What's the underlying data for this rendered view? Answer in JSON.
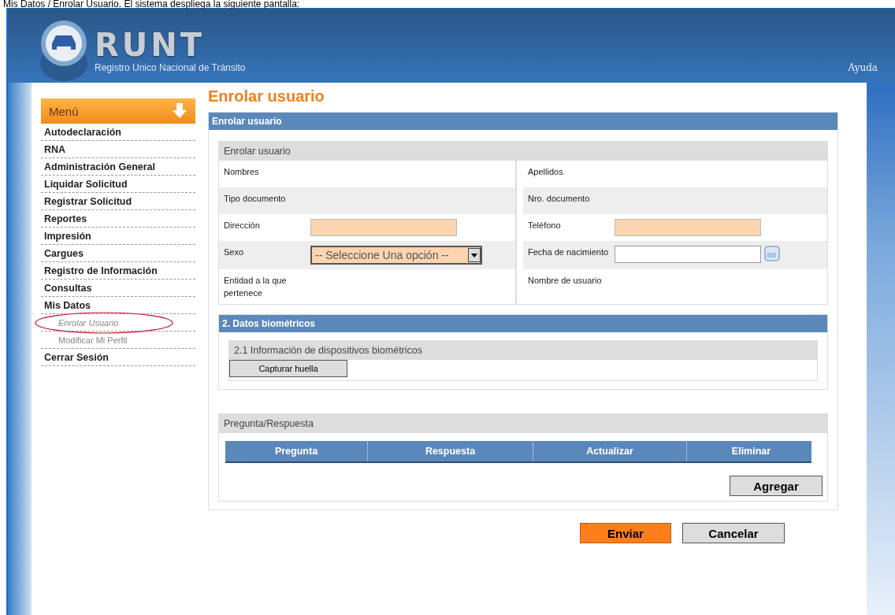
{
  "document_text": "Mis Datos / Enrolar Usuario. El sistema despliega la siguiente pantalla:",
  "header": {
    "logo_text": "RUNT",
    "subtitle": "Registro Unico Nacional de Tránsito",
    "help_link": "Ayuda"
  },
  "menu": {
    "title": "Menú",
    "items": [
      {
        "label": "Autodeclaración",
        "kind": "main",
        "selected": false
      },
      {
        "label": "RNA",
        "kind": "main",
        "selected": false
      },
      {
        "label": "Administración General",
        "kind": "main",
        "selected": false
      },
      {
        "label": "Liquidar Solicitud",
        "kind": "main",
        "selected": false
      },
      {
        "label": "Registrar Solicitud",
        "kind": "main",
        "selected": false
      },
      {
        "label": "Reportes",
        "kind": "main",
        "selected": false
      },
      {
        "label": "Impresión",
        "kind": "main",
        "selected": false
      },
      {
        "label": "Cargues",
        "kind": "main",
        "selected": false
      },
      {
        "label": "Registro de Información",
        "kind": "main",
        "selected": false
      },
      {
        "label": "Consultas",
        "kind": "main",
        "selected": false
      },
      {
        "label": "Mis Datos",
        "kind": "main",
        "selected": false
      },
      {
        "label": "Enrolar Usuario",
        "kind": "sub",
        "selected": true
      },
      {
        "label": "Modificar Mi Perfil",
        "kind": "sub",
        "selected": false
      },
      {
        "label": "Cerrar Sesión",
        "kind": "main",
        "selected": false
      }
    ]
  },
  "page_title": "Enrolar usuario",
  "panel_title": "Enrolar usuario",
  "user_section": {
    "title": "Enrolar usuario",
    "rows": [
      {
        "shaded": false,
        "left": {
          "label": "Nombres",
          "kind": "text"
        },
        "right": {
          "label": "Apellidos",
          "kind": "text"
        }
      },
      {
        "shaded": true,
        "left": {
          "label": "Tipo documento",
          "kind": "text"
        },
        "right": {
          "label": "Nro. documento",
          "kind": "text"
        }
      },
      {
        "shaded": false,
        "left": {
          "label": "Dirección",
          "kind": "input"
        },
        "right": {
          "label": "Teléfono",
          "kind": "input"
        }
      },
      {
        "shaded": true,
        "left": {
          "label": "Sexo",
          "kind": "select",
          "value": "-- Seleccione Una opción --"
        },
        "right": {
          "label": "Fecha de nacimiento",
          "kind": "date"
        }
      },
      {
        "shaded": false,
        "left": {
          "label": "Entidad a la que pertenece",
          "kind": "text"
        },
        "right": {
          "label": "Nombre de usuario",
          "kind": "text"
        }
      }
    ]
  },
  "biometrics": {
    "title": "2. Datos biométricos",
    "subtitle": "2.1 Información de dispositivos biométricos",
    "button": "Capturar huella"
  },
  "qa": {
    "title": "Pregunta/Respuesta",
    "columns": [
      "Pregunta",
      "Respuesta",
      "Actualizar",
      "Eliminar"
    ],
    "add_button": "Agregar"
  },
  "actions": [
    {
      "label": "Enviar",
      "kind": "primary"
    },
    {
      "label": "Cancelar",
      "kind": "secondary"
    }
  ]
}
